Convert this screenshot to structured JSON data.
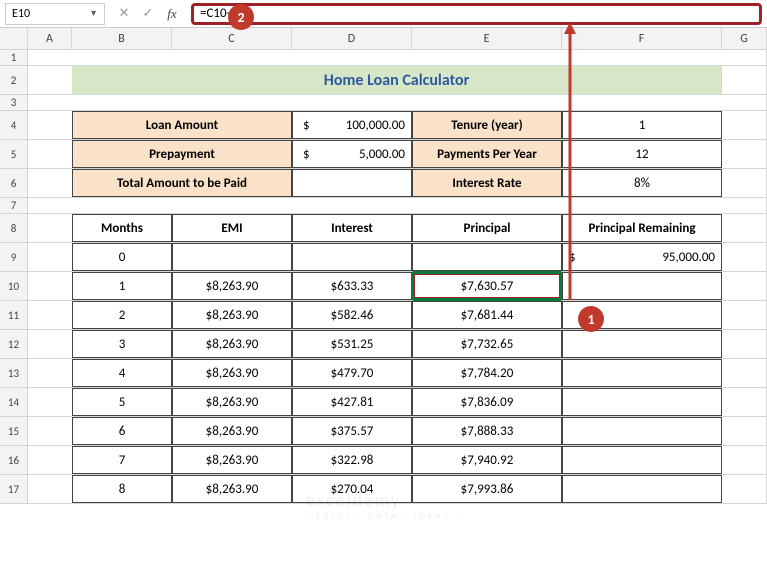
{
  "formula_bar": {
    "name_box": "E10",
    "formula": "=C10-D10"
  },
  "columns": [
    "A",
    "B",
    "C",
    "D",
    "E",
    "F",
    "G"
  ],
  "title": "Home Loan Calculator",
  "params": {
    "loan_amount_label": "Loan Amount",
    "loan_amount_sym": "$",
    "loan_amount_val": "100,000.00",
    "prepayment_label": "Prepayment",
    "prepayment_sym": "$",
    "prepayment_val": "5,000.00",
    "total_paid_label": "Total Amount to be Paid",
    "tenure_label": "Tenure (year)",
    "tenure_val": "1",
    "ppy_label": "Payments Per Year",
    "ppy_val": "12",
    "rate_label": "Interest Rate",
    "rate_val": "8%"
  },
  "table": {
    "headers": {
      "months": "Months",
      "emi": "EMI",
      "interest": "Interest",
      "principal": "Principal",
      "remaining": "Principal Remaining"
    },
    "rows": [
      {
        "m": "0",
        "emi": "",
        "int": "",
        "prin": "",
        "rem_sym": "$",
        "rem": "95,000.00"
      },
      {
        "m": "1",
        "emi": "$8,263.90",
        "int": "$633.33",
        "prin": "$7,630.57",
        "rem": ""
      },
      {
        "m": "2",
        "emi": "$8,263.90",
        "int": "$582.46",
        "prin": "$7,681.44",
        "rem": ""
      },
      {
        "m": "3",
        "emi": "$8,263.90",
        "int": "$531.25",
        "prin": "$7,732.65",
        "rem": ""
      },
      {
        "m": "4",
        "emi": "$8,263.90",
        "int": "$479.70",
        "prin": "$7,784.20",
        "rem": ""
      },
      {
        "m": "5",
        "emi": "$8,263.90",
        "int": "$427.81",
        "prin": "$7,836.09",
        "rem": ""
      },
      {
        "m": "6",
        "emi": "$8,263.90",
        "int": "$375.57",
        "prin": "$7,888.33",
        "rem": ""
      },
      {
        "m": "7",
        "emi": "$8,263.90",
        "int": "$322.98",
        "prin": "$7,940.92",
        "rem": ""
      },
      {
        "m": "8",
        "emi": "$8,263.90",
        "int": "$270.04",
        "prin": "$7,993.86",
        "rem": ""
      }
    ]
  },
  "callouts": {
    "c1": "1",
    "c2": "2"
  },
  "watermark": {
    "main": "exceldemy",
    "sub": "· EXCEL · DATA · IDEAS ·"
  }
}
